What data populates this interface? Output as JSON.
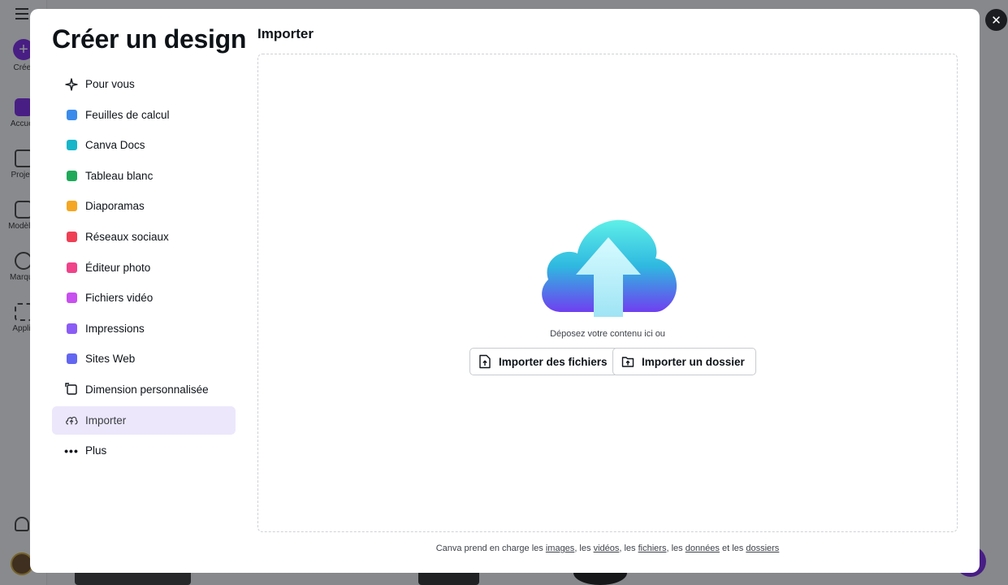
{
  "background": {
    "rail": [
      {
        "label": "Créer",
        "icon": "plus-icon"
      },
      {
        "label": "Accueil",
        "icon": "home-icon"
      },
      {
        "label": "Projets",
        "icon": "folder-icon"
      },
      {
        "label": "Modèles",
        "icon": "templates-icon"
      },
      {
        "label": "Marque",
        "icon": "brand-icon"
      },
      {
        "label": "Applis",
        "icon": "apps-icon"
      }
    ]
  },
  "modal": {
    "title": "Créer un design",
    "close_icon": "close-icon",
    "menu": [
      {
        "label": "Pour vous",
        "icon": "sparkle-icon",
        "color": "#0e1318"
      },
      {
        "label": "Feuilles de calcul",
        "icon": "spreadsheet-icon",
        "color": "#3b8beb"
      },
      {
        "label": "Canva Docs",
        "icon": "docs-icon",
        "color": "#19b5c8"
      },
      {
        "label": "Tableau blanc",
        "icon": "whiteboard-icon",
        "color": "#1faa5a"
      },
      {
        "label": "Diaporamas",
        "icon": "presentation-icon",
        "color": "#f5a623"
      },
      {
        "label": "Réseaux sociaux",
        "icon": "heart-icon",
        "color": "#ef3f55"
      },
      {
        "label": "Éditeur photo",
        "icon": "camera-icon",
        "color": "#f0438a"
      },
      {
        "label": "Fichiers vidéo",
        "icon": "video-icon",
        "color": "#c84ff0"
      },
      {
        "label": "Impressions",
        "icon": "printer-icon",
        "color": "#8b5cf6"
      },
      {
        "label": "Sites Web",
        "icon": "website-icon",
        "color": "#6366f1"
      },
      {
        "label": "Dimension personnalisée",
        "icon": "resize-icon",
        "color": "#0e1318"
      },
      {
        "label": "Importer",
        "icon": "cloud-upload-icon",
        "color": "#0e1318",
        "active": true
      },
      {
        "label": "Plus",
        "icon": "more-icon",
        "color": "#0e1318"
      }
    ],
    "panel": {
      "title": "Importer",
      "drop_text": "Déposez votre contenu ici ou",
      "upload_files_label": "Importer des fichiers",
      "upload_folder_label": "Importer un dossier",
      "footer": {
        "prefix": "Canva prend en charge les",
        "images": "images",
        "sep1": ", les",
        "videos": "vidéos",
        "sep2": ", les",
        "files": "fichiers",
        "sep3": ", les",
        "data": "données",
        "sep4": "et les",
        "folders": "dossiers"
      }
    }
  }
}
